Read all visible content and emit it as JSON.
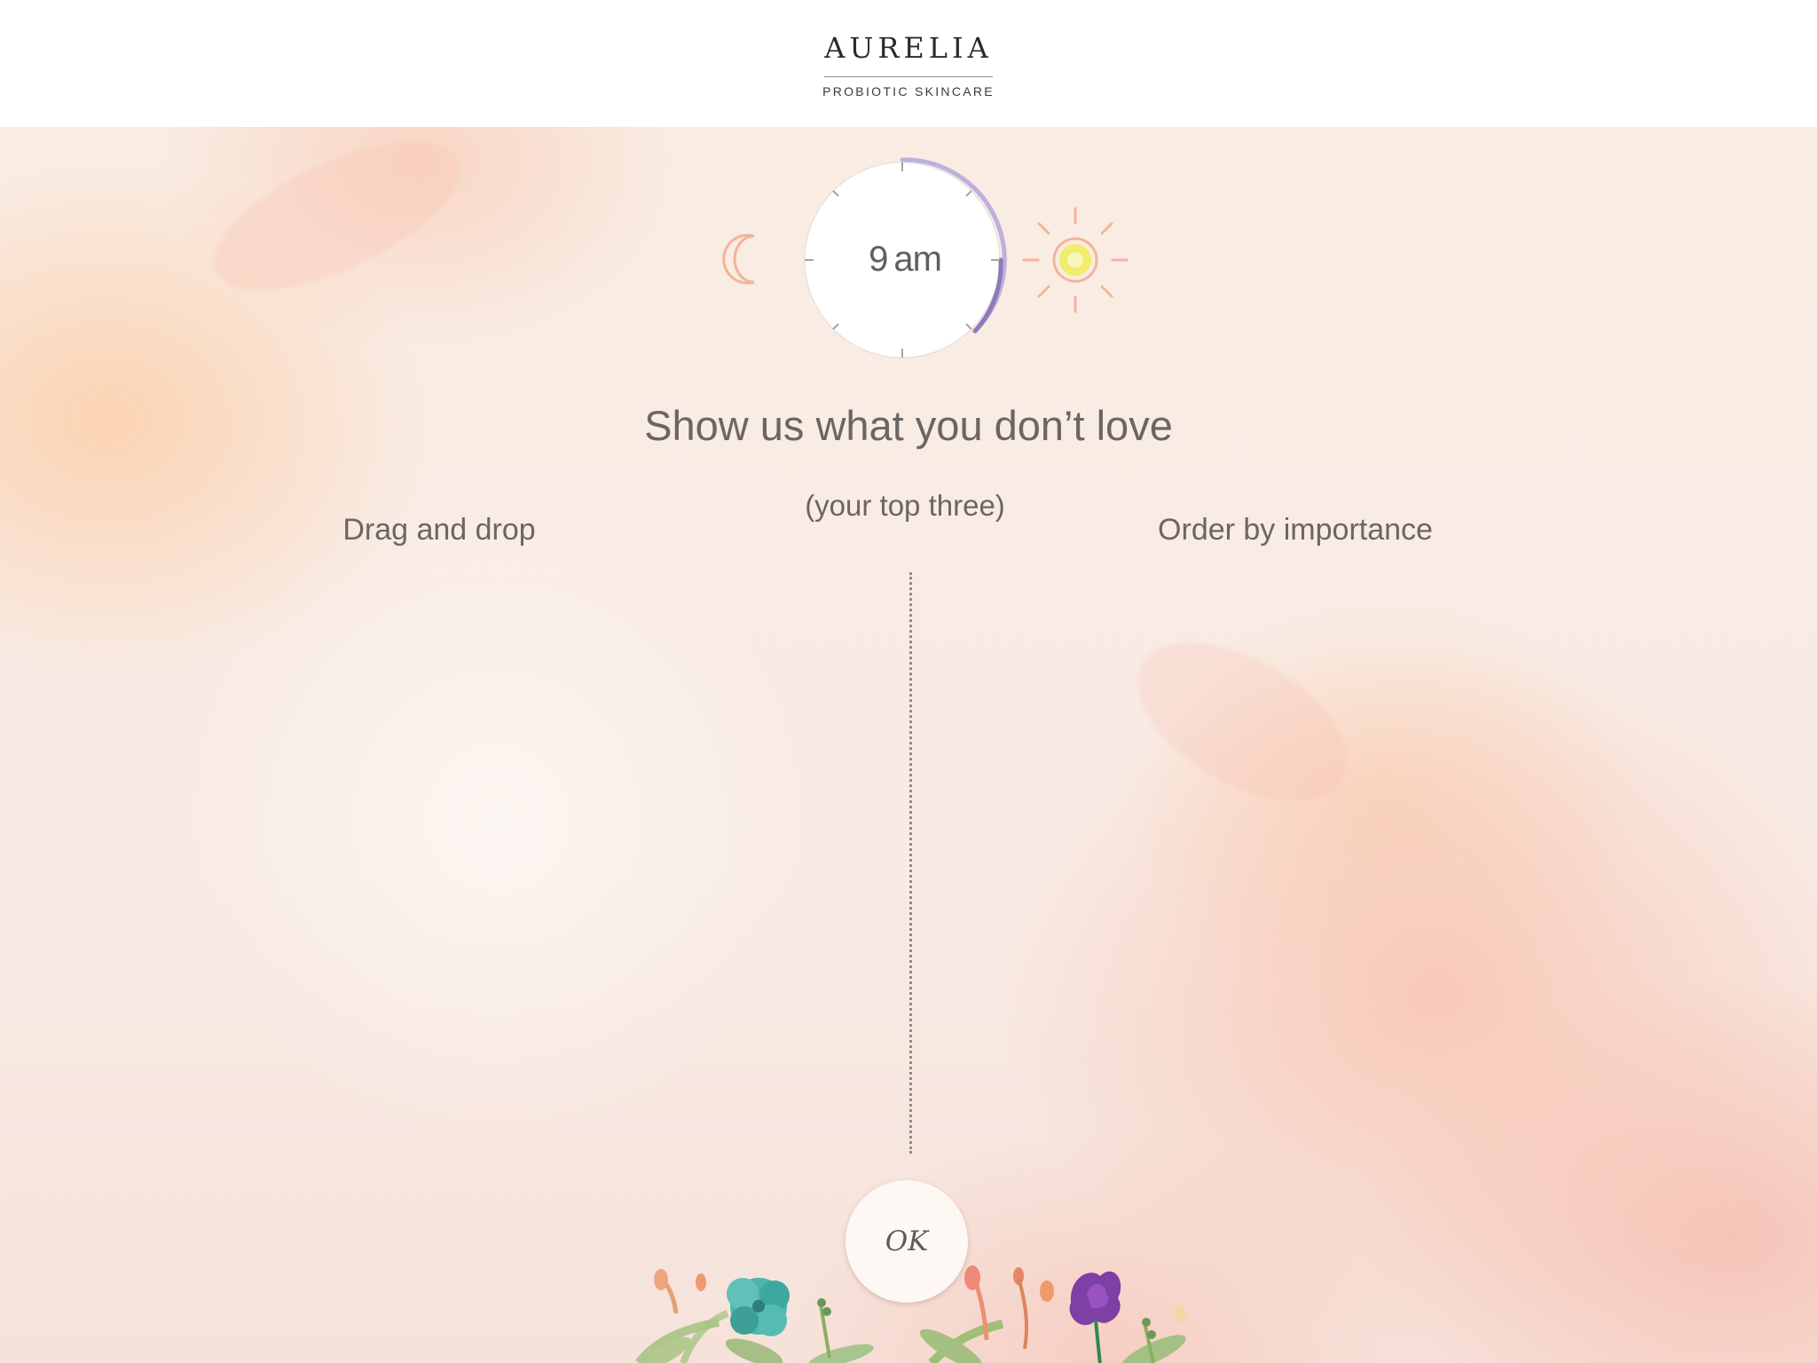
{
  "brand": {
    "name": "AURELIA",
    "tagline": "PROBIOTIC SKINCARE"
  },
  "time_selector": {
    "time": "9",
    "period": "am",
    "left_icon": "moon-icon",
    "right_icon": "sun-icon",
    "accent_color": "#9b86c0"
  },
  "question": {
    "title": "Show us what you don’t love",
    "subtitle": "(your top three)",
    "left_hint": "Drag and drop",
    "right_hint": "Order by importance"
  },
  "actions": {
    "ok_label": "OK"
  },
  "colors": {
    "icon_peach": "#f3b49b",
    "sun_core": "#f1ec6a"
  }
}
